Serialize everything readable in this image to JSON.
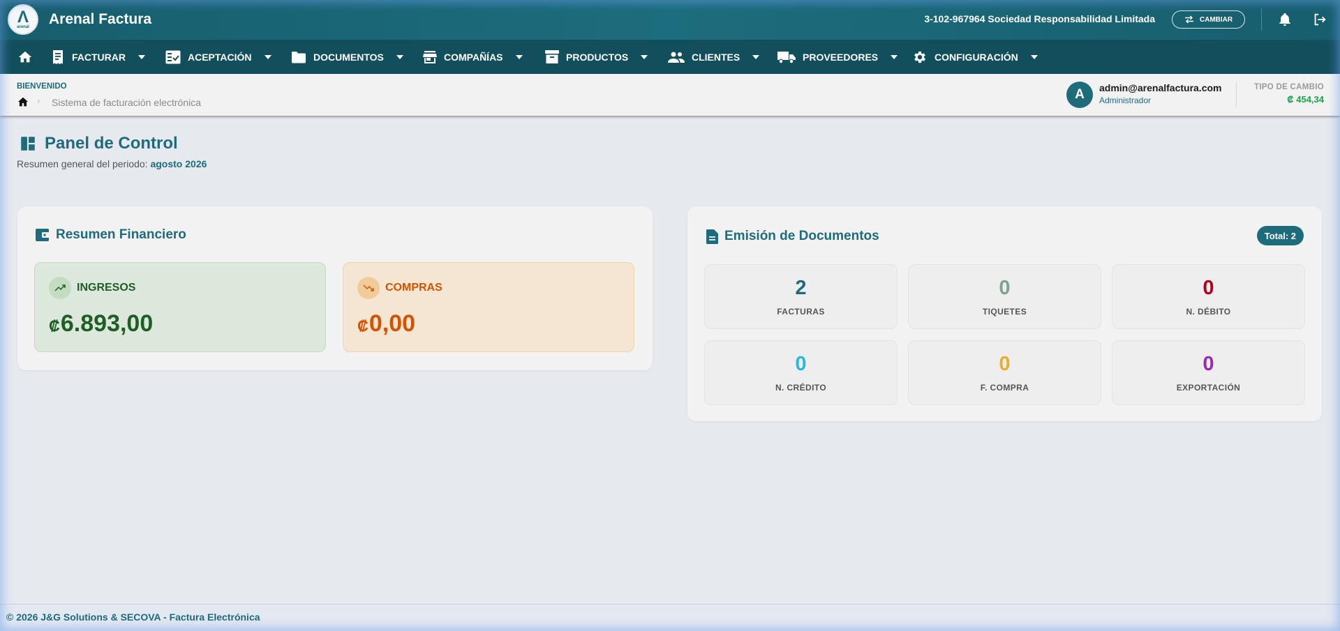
{
  "header": {
    "app_title": "Arenal Factura",
    "logo_glyph": "Λ",
    "logo_sub": "arenal",
    "company": "3-102-967964 Sociedad Responsabilidad Limitada",
    "switch_label": "CAMBIAR"
  },
  "nav": {
    "items": [
      {
        "label": "FACTURAR",
        "icon": "receipt-icon"
      },
      {
        "label": "ACEPTACIÓN",
        "icon": "fact-check-icon"
      },
      {
        "label": "DOCUMENTOS",
        "icon": "folder-icon"
      },
      {
        "label": "COMPAÑÍAS",
        "icon": "store-icon"
      },
      {
        "label": "PRODUCTOS",
        "icon": "archive-icon"
      },
      {
        "label": "CLIENTES",
        "icon": "people-icon"
      },
      {
        "label": "PROVEEDORES",
        "icon": "truck-icon"
      },
      {
        "label": "CONFIGURACIÓN",
        "icon": "gear-icon"
      }
    ]
  },
  "breadcrumb": {
    "welcome": "BIENVENIDO",
    "current": "Sistema de facturación electrónica"
  },
  "user": {
    "initial": "A",
    "email": "admin@arenalfactura.com",
    "role": "Administrador"
  },
  "exchange": {
    "label": "TIPO DE CAMBIO",
    "value": "₡ 454,34"
  },
  "page": {
    "title": "Panel de Control",
    "subtitle_prefix": "Resumen general del periodo: ",
    "period": "agosto 2026"
  },
  "financial": {
    "title": "Resumen Financiero",
    "currency": "₡",
    "ingresos": {
      "label": "INGRESOS",
      "value": "6.893,00",
      "color": "#1f5e25"
    },
    "compras": {
      "label": "COMPRAS",
      "value": "0,00",
      "color": "#d35400"
    }
  },
  "documents": {
    "title": "Emisión de Documentos",
    "total": "Total: 2",
    "tiles": [
      {
        "count": "2",
        "label": "FACTURAS",
        "color": "#1d6b7b"
      },
      {
        "count": "0",
        "label": "TIQUETES",
        "color": "#7ba590"
      },
      {
        "count": "0",
        "label": "N. DÉBITO",
        "color": "#b3001b"
      },
      {
        "count": "0",
        "label": "N. CRÉDITO",
        "color": "#29b8d8"
      },
      {
        "count": "0",
        "label": "F. COMPRA",
        "color": "#e6ad2e"
      },
      {
        "count": "0",
        "label": "EXPORTACIÓN",
        "color": "#9c27b0"
      }
    ]
  },
  "footer": {
    "text": "© 2026 J&G Solutions & SECOVA - Factura Electrónica"
  }
}
